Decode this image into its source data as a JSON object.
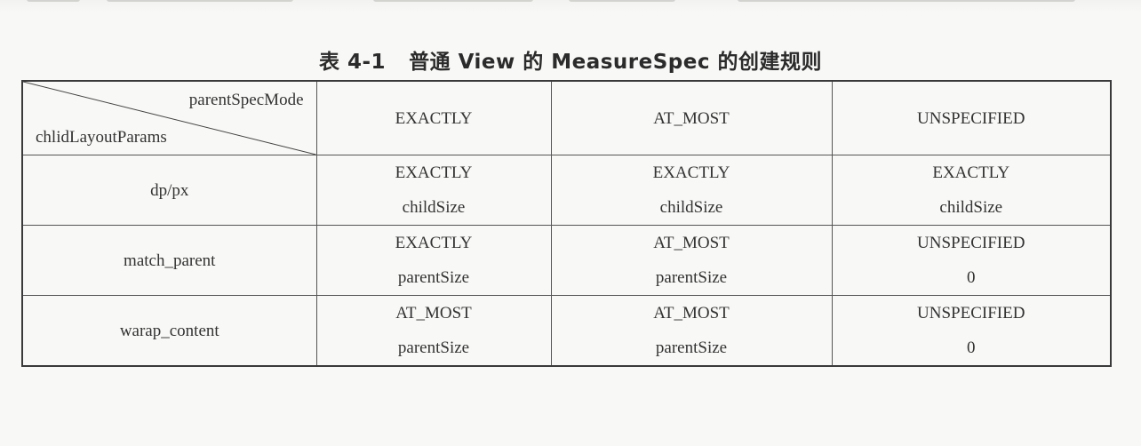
{
  "caption": {
    "number": "表 4-1",
    "title": "普通 View 的 MeasureSpec 的创建规则"
  },
  "table": {
    "corner": {
      "parent_label": "parentSpecMode",
      "child_label": "chlidLayoutParams"
    },
    "columns": [
      "EXACTLY",
      "AT_MOST",
      "UNSPECIFIED"
    ],
    "rows": [
      {
        "label": "dp/px",
        "cells": [
          [
            "EXACTLY",
            "childSize"
          ],
          [
            "EXACTLY",
            "childSize"
          ],
          [
            "EXACTLY",
            "childSize"
          ]
        ]
      },
      {
        "label": "match_parent",
        "cells": [
          [
            "EXACTLY",
            "parentSize"
          ],
          [
            "AT_MOST",
            "parentSize"
          ],
          [
            "UNSPECIFIED",
            "0"
          ]
        ]
      },
      {
        "label": "warap_content",
        "cells": [
          [
            "AT_MOST",
            "parentSize"
          ],
          [
            "AT_MOST",
            "parentSize"
          ],
          [
            "UNSPECIFIED",
            "0"
          ]
        ]
      }
    ]
  }
}
